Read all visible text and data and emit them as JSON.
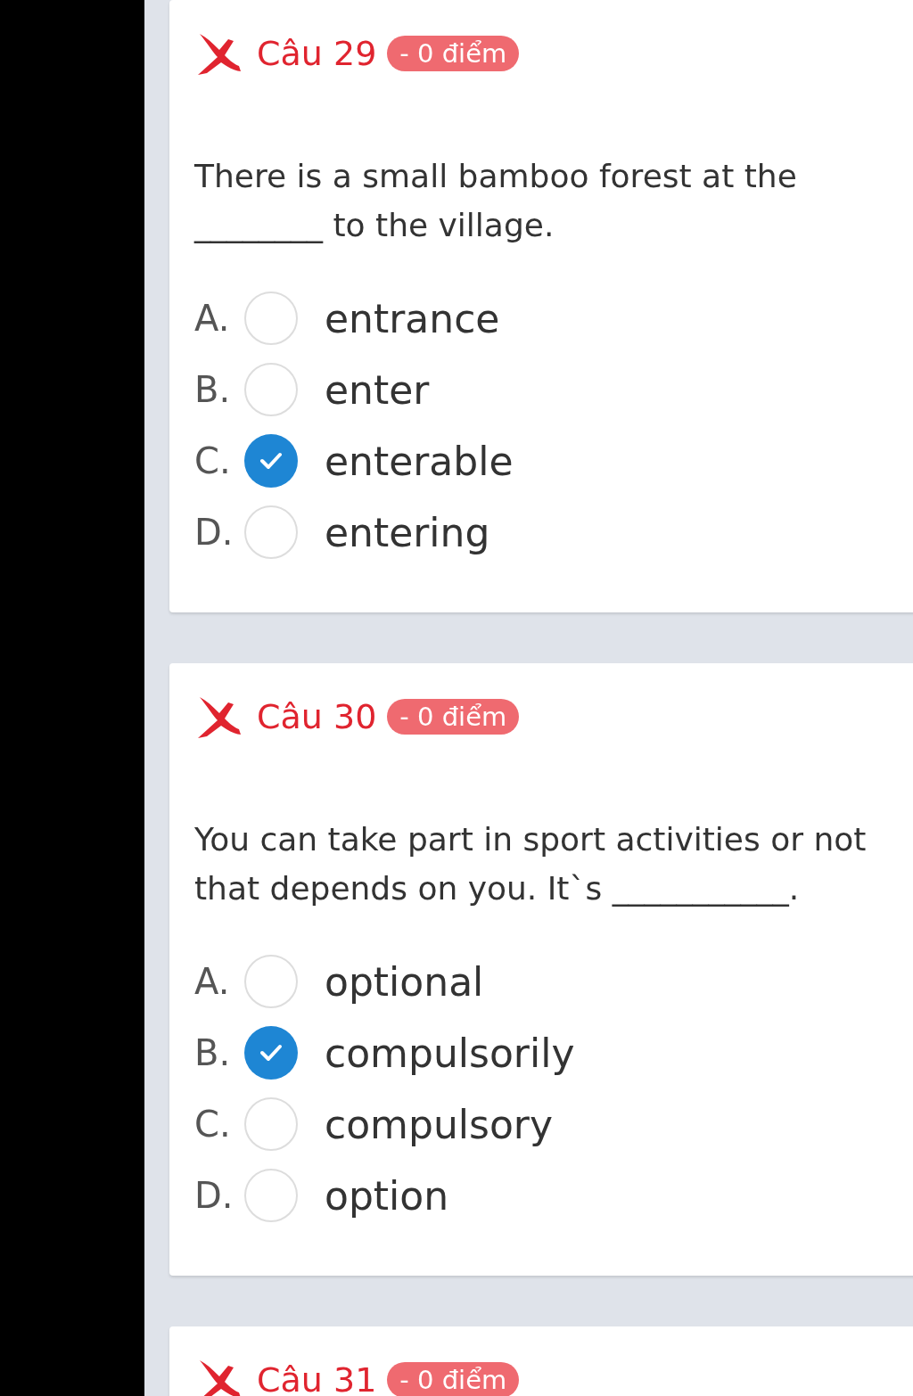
{
  "questions": [
    {
      "number": "Câu 29",
      "correct": false,
      "score": "- 0 điểm",
      "text": "________ to the village.",
      "text_lead": "There is a small bamboo forest at the",
      "options": [
        {
          "letter": "A.",
          "text": "entrance",
          "selected": false
        },
        {
          "letter": "B.",
          "text": "enter",
          "selected": false
        },
        {
          "letter": "C.",
          "text": "enterable",
          "selected": true
        },
        {
          "letter": "D.",
          "text": "entering",
          "selected": false
        }
      ]
    },
    {
      "number": "Câu 30",
      "correct": false,
      "score": "- 0 điểm",
      "text_lead": "You can take part in sport activities or not",
      "text": "that depends on you. It`s ___________.",
      "options": [
        {
          "letter": "A.",
          "text": "optional",
          "selected": false
        },
        {
          "letter": "B.",
          "text": "compulsorily",
          "selected": true
        },
        {
          "letter": "C.",
          "text": "compulsory",
          "selected": false
        },
        {
          "letter": "D.",
          "text": "option",
          "selected": false
        }
      ]
    },
    {
      "number": "Câu 31",
      "correct": false,
      "score": "- 0 điểm"
    }
  ]
}
